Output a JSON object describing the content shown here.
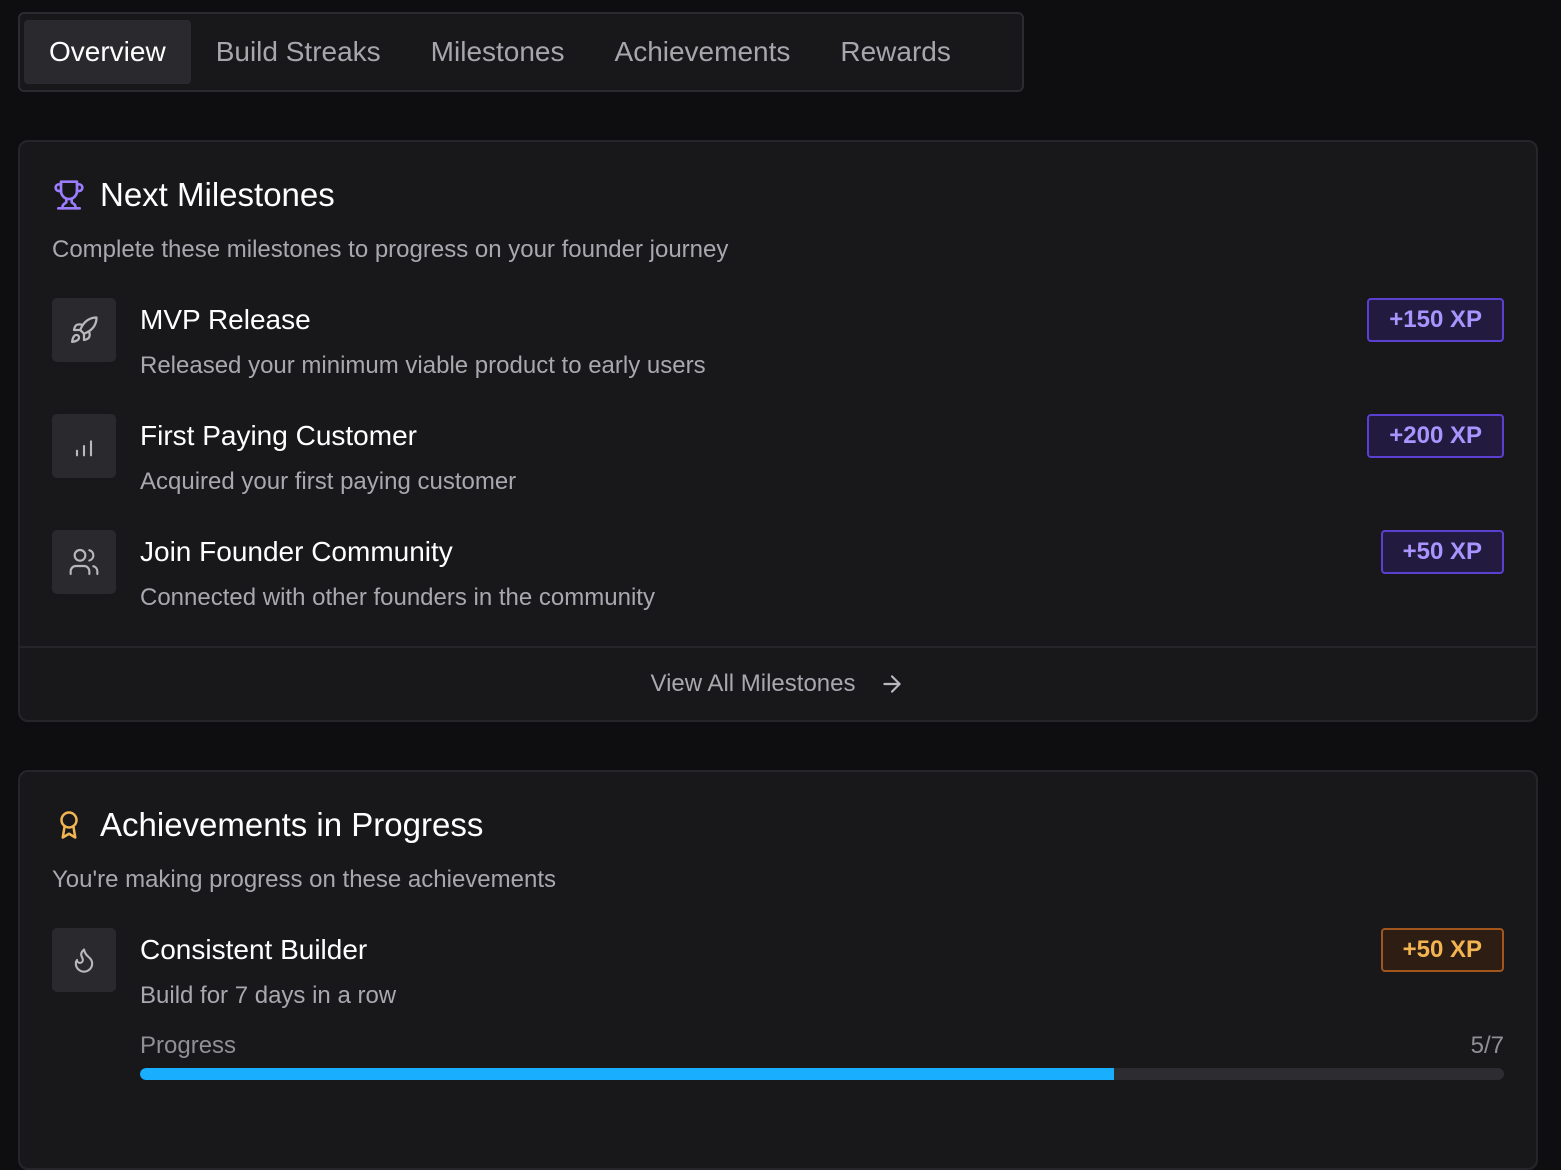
{
  "tabs": [
    {
      "label": "Overview",
      "active": true
    },
    {
      "label": "Build Streaks",
      "active": false
    },
    {
      "label": "Milestones",
      "active": false
    },
    {
      "label": "Achievements",
      "active": false
    },
    {
      "label": "Rewards",
      "active": false
    }
  ],
  "milestones": {
    "icon": "trophy-icon",
    "title": "Next Milestones",
    "description": "Complete these milestones to progress on your founder journey",
    "items": [
      {
        "icon": "rocket-icon",
        "title": "MVP Release",
        "description": "Released your minimum viable product to early users",
        "xp": "+150 XP"
      },
      {
        "icon": "bar-chart-icon",
        "title": "First Paying Customer",
        "description": "Acquired your first paying customer",
        "xp": "+200 XP"
      },
      {
        "icon": "users-icon",
        "title": "Join Founder Community",
        "description": "Connected with other founders in the community",
        "xp": "+50 XP"
      }
    ],
    "footer_label": "View All Milestones"
  },
  "achievements": {
    "icon": "award-icon",
    "title": "Achievements in Progress",
    "description": "You're making progress on these achievements",
    "items": [
      {
        "icon": "flame-icon",
        "title": "Consistent Builder",
        "description": "Build for 7 days in a row",
        "xp": "+50 XP",
        "progress_label": "Progress",
        "progress_text": "5/7",
        "progress_fraction": 0.714
      }
    ]
  },
  "colors": {
    "accent_purple": "#a995ff",
    "accent_orange": "#f2b552",
    "progress_blue": "#1aaeff",
    "background": "#0e0e10",
    "card": "#18181b"
  }
}
